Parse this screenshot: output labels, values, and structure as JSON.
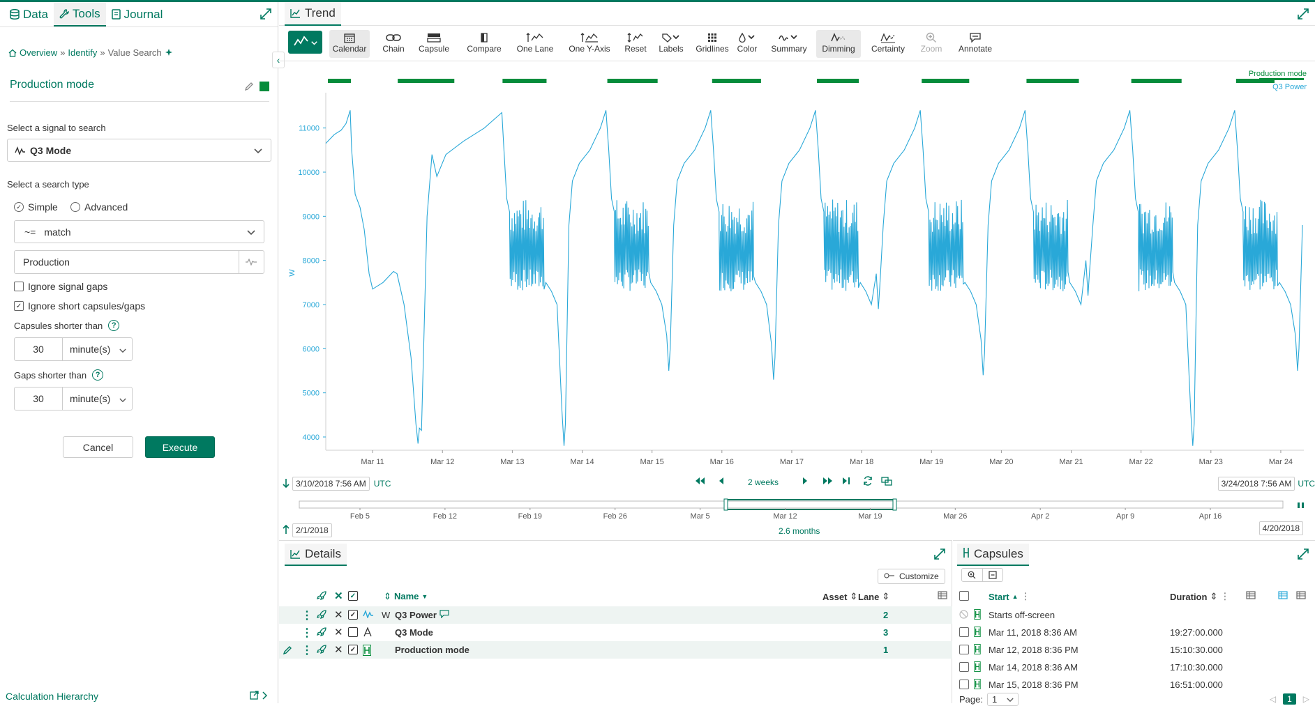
{
  "left_panel": {
    "tabs": [
      {
        "label": "Data",
        "icon": "database-icon"
      },
      {
        "label": "Tools",
        "icon": "wrench-icon"
      },
      {
        "label": "Journal",
        "icon": "journal-icon"
      }
    ],
    "breadcrumb": {
      "overview": "Overview",
      "identify": "Identify",
      "current": "Value Search",
      "sep": "»"
    },
    "form_title": "Production mode",
    "form_color": "#068c3b",
    "signal_label": "Select a signal to search",
    "signal_value": "Q3 Mode",
    "search_type_label": "Select a search type",
    "radio_simple": "Simple",
    "radio_advanced": "Advanced",
    "operator_symbol": "~=",
    "operator_value": "match",
    "search_value": "Production",
    "ignore_gaps": "Ignore signal gaps",
    "ignore_short": "Ignore short capsules/gaps",
    "capsules_shorter": "Capsules shorter than",
    "capsules_value": "30",
    "capsules_unit": "minute(s)",
    "gaps_shorter": "Gaps shorter than",
    "gaps_value": "30",
    "gaps_unit": "minute(s)",
    "cancel": "Cancel",
    "execute": "Execute",
    "calc_hierarchy": "Calculation Hierarchy"
  },
  "trend": {
    "title": "Trend",
    "toolbar": [
      {
        "label": "Calendar",
        "icon": "calendar-icon",
        "active": true
      },
      {
        "label": "Chain",
        "icon": "chain-icon"
      },
      {
        "label": "Capsule",
        "icon": "capsule-icon"
      },
      {
        "label": "Compare",
        "icon": "compare-icon"
      },
      {
        "label": "One Lane",
        "icon": "one-lane-icon"
      },
      {
        "label": "One Y-Axis",
        "icon": "one-y-axis-icon"
      },
      {
        "label": "Reset",
        "icon": "reset-icon"
      },
      {
        "label": "Labels",
        "icon": "tag-icon"
      },
      {
        "label": "Gridlines",
        "icon": "grid-icon"
      },
      {
        "label": "Color",
        "icon": "droplet-icon"
      },
      {
        "label": "Summary",
        "icon": "summary-icon"
      },
      {
        "label": "Dimming",
        "icon": "dimming-icon",
        "active": true
      },
      {
        "label": "Certainty",
        "icon": "certainty-icon"
      },
      {
        "label": "Zoom",
        "icon": "zoom-icon",
        "disabled": true
      },
      {
        "label": "Annotate",
        "icon": "comment-icon"
      }
    ],
    "display_start": "3/10/2018 7:56 AM",
    "display_end": "3/24/2018 7:56 AM",
    "tz": "UTC",
    "duration": "2 weeks",
    "investigate_start": "2/1/2018",
    "investigate_end": "4/20/2018",
    "investigate_duration": "2.6 months",
    "overview_ticks": [
      "Feb 5",
      "Feb 12",
      "Feb 19",
      "Feb 26",
      "Mar 5",
      "Mar 12",
      "Mar 19",
      "Mar 26",
      "Apr 2",
      "Apr 9",
      "Apr 16"
    ]
  },
  "chart_data": {
    "type": "line",
    "ylabel": "W",
    "y_ticks": [
      4000,
      5000,
      6000,
      7000,
      8000,
      9000,
      10000,
      11000
    ],
    "ylim": [
      3700,
      11800
    ],
    "x_ticks": [
      "Mar 11",
      "Mar 12",
      "Mar 13",
      "Mar 14",
      "Mar 15",
      "Mar 16",
      "Mar 17",
      "Mar 18",
      "Mar 19",
      "Mar 20",
      "Mar 21",
      "Mar 22",
      "Mar 23",
      "Mar 24"
    ],
    "xlim_days": [
      10.33,
      24.33
    ],
    "legend": [
      "Production mode",
      "Q3 Power"
    ],
    "series": [
      {
        "name": "Q3 Power",
        "color": "#29a8d8",
        "cycle_peak": 11400,
        "cycle_trough": 7300,
        "min_values": [
          3800,
          5500,
          5300,
          6900,
          5400,
          7200
        ]
      },
      {
        "name": "Production mode",
        "color": "#068c3b",
        "capsule_starts": [
          "Mar 10, 8:36 AM",
          "Mar 11, 8:36 AM",
          "Mar 12, 8:36 PM",
          "Mar 14, 8:36 AM",
          "Mar 15, 8:36 PM",
          "Mar 17, 8:36 AM",
          "Mar 18, 8:36 PM",
          "Mar 20, 8:36 AM",
          "Mar 21, 8:36 PM",
          "Mar 23, 8:36 AM"
        ]
      }
    ]
  },
  "details": {
    "title": "Details",
    "customize": "Customize",
    "col_name": "Name",
    "col_asset": "Asset",
    "col_lane": "Lane",
    "rows": [
      {
        "unit": "W",
        "name": "Q3 Power",
        "lane": "2",
        "checked": true,
        "icon": "signal-icon"
      },
      {
        "unit": "",
        "name": "Q3 Mode",
        "lane": "3",
        "checked": false,
        "icon": "string-signal-icon"
      },
      {
        "unit": "",
        "name": "Production mode",
        "lane": "1",
        "checked": true,
        "icon": "condition-icon"
      }
    ]
  },
  "capsules": {
    "title": "Capsules",
    "col_start": "Start",
    "col_duration": "Duration",
    "offscreen": "Starts off-screen",
    "rows": [
      {
        "start": "Mar 11, 2018 8:36 AM",
        "duration": "19:27:00.000"
      },
      {
        "start": "Mar 12, 2018 8:36 PM",
        "duration": "15:10:30.000"
      },
      {
        "start": "Mar 14, 2018 8:36 AM",
        "duration": "17:10:30.000"
      },
      {
        "start": "Mar 15, 2018 8:36 PM",
        "duration": "16:51:00.000"
      }
    ],
    "page_label": "Page:",
    "page_value": "1",
    "page_current": "1"
  }
}
